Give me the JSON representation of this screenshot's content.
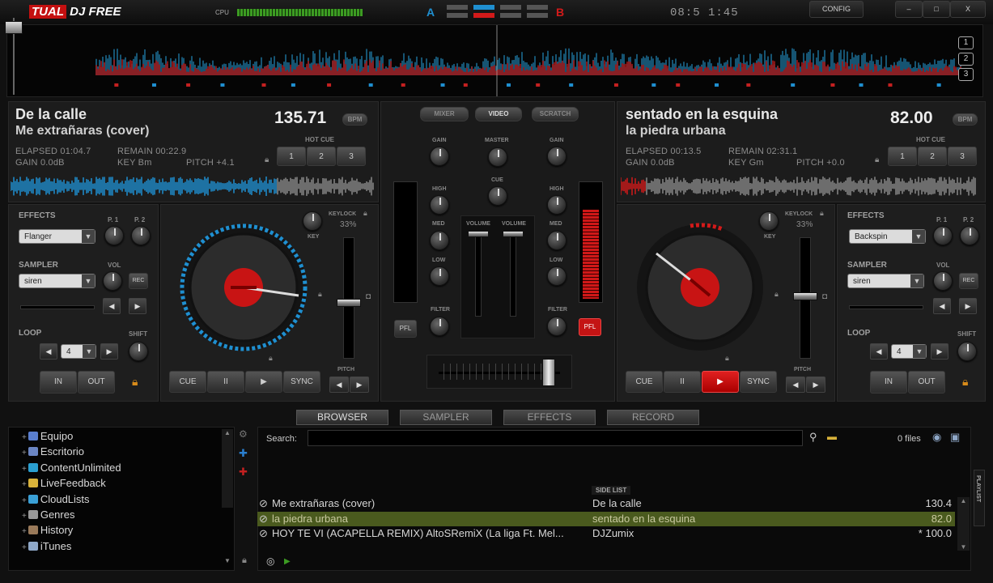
{
  "app": {
    "logo_part1": "TUAL",
    "logo_part2": "DJ FREE",
    "cpu_label": "CPU",
    "clock": "08:5 1:45",
    "config": "CONFIG",
    "minimize": "–",
    "maximize": "□",
    "close": "X",
    "crossfader_a": "A",
    "crossfader_b": "B"
  },
  "overview": {
    "markers": [
      "1",
      "2",
      "3"
    ]
  },
  "deck_left": {
    "title": "De la calle",
    "artist": "Me extrañaras (cover)",
    "bpm": "135.71",
    "bpm_label": "BPM",
    "elapsed": "ELAPSED 01:04.7",
    "remain": "REMAIN 00:22.9",
    "gain": "GAIN 0.0dB",
    "key": "KEY Bm",
    "pitch": "PITCH +4.1",
    "hot_cue_label": "HOT CUE",
    "hot_cues": [
      "1",
      "2",
      "3"
    ],
    "effects_label": "EFFECTS",
    "effect": "Flanger",
    "p1": "P. 1",
    "p2": "P. 2",
    "sampler_label": "SAMPLER",
    "sample": "siren",
    "vol": "VOL",
    "rec": "REC",
    "loop_label": "LOOP",
    "loop_value": "4",
    "shift": "SHIFT",
    "in": "IN",
    "out": "OUT",
    "keylock": "KEYLOCK",
    "keylock_pct": "33%",
    "key_label": "KEY",
    "pitch_label": "PITCH",
    "transport": [
      "CUE",
      "II",
      "▶",
      "SYNC"
    ]
  },
  "deck_right": {
    "title": "sentado en la esquina",
    "artist": "la piedra urbana",
    "bpm": "82.00",
    "bpm_label": "BPM",
    "elapsed": "ELAPSED 00:13.5",
    "remain": "REMAIN 02:31.1",
    "gain": "GAIN 0.0dB",
    "key": "KEY Gm",
    "pitch": "PITCH +0.0",
    "hot_cue_label": "HOT CUE",
    "hot_cues": [
      "1",
      "2",
      "3"
    ],
    "effects_label": "EFFECTS",
    "effect": "Backspin",
    "p1": "P. 1",
    "p2": "P. 2",
    "sampler_label": "SAMPLER",
    "sample": "siren",
    "vol": "VOL",
    "rec": "REC",
    "loop_label": "LOOP",
    "loop_value": "4",
    "shift": "SHIFT",
    "in": "IN",
    "out": "OUT",
    "keylock": "KEYLOCK",
    "keylock_pct": "33%",
    "key_label": "KEY",
    "pitch_label": "PITCH",
    "transport": [
      "CUE",
      "II",
      "▶",
      "SYNC"
    ]
  },
  "mixer": {
    "tabs": [
      "MIXER",
      "VIDEO",
      "SCRATCH"
    ],
    "gain": "GAIN",
    "master": "MASTER",
    "cue": "CUE",
    "high": "HIGH",
    "med": "MED",
    "low": "LOW",
    "filter": "FILTER",
    "volume": "VOLUME",
    "pfl": "PFL"
  },
  "browser": {
    "tabs": [
      "BROWSER",
      "SAMPLER",
      "EFFECTS",
      "RECORD"
    ],
    "search_label": "Search:",
    "search_value": "",
    "file_count": "0 files",
    "side_list": "SIDE LIST",
    "playlist": "PLAYLIST",
    "tree": [
      {
        "label": "Equipo",
        "color": "#5a7fd0"
      },
      {
        "label": "Escritorio",
        "color": "#6b86c4"
      },
      {
        "label": "ContentUnlimited",
        "color": "#2a9fd0"
      },
      {
        "label": "LiveFeedback",
        "color": "#d8b23a"
      },
      {
        "label": "CloudLists",
        "color": "#3aa0d6"
      },
      {
        "label": "Genres",
        "color": "#999999"
      },
      {
        "label": "History",
        "color": "#9a7a5a"
      },
      {
        "label": "iTunes",
        "color": "#8fa8c8"
      }
    ],
    "files": [
      {
        "title": "Me extrañaras (cover)",
        "artist": "De la calle",
        "bpm": "130.4"
      },
      {
        "title": "la piedra urbana",
        "artist": "sentado en la esquina",
        "bpm": "82.0"
      },
      {
        "title": "HOY TE VI (ACAPELLA REMIX) AltoSRemiX (La liga Ft. Mel...",
        "artist": "DJZumix",
        "bpm": "* 100.0"
      }
    ]
  },
  "colors": {
    "deck_a": "#1f8fd0",
    "deck_b": "#d21a1a",
    "selected_row": "#4a5a1e"
  }
}
